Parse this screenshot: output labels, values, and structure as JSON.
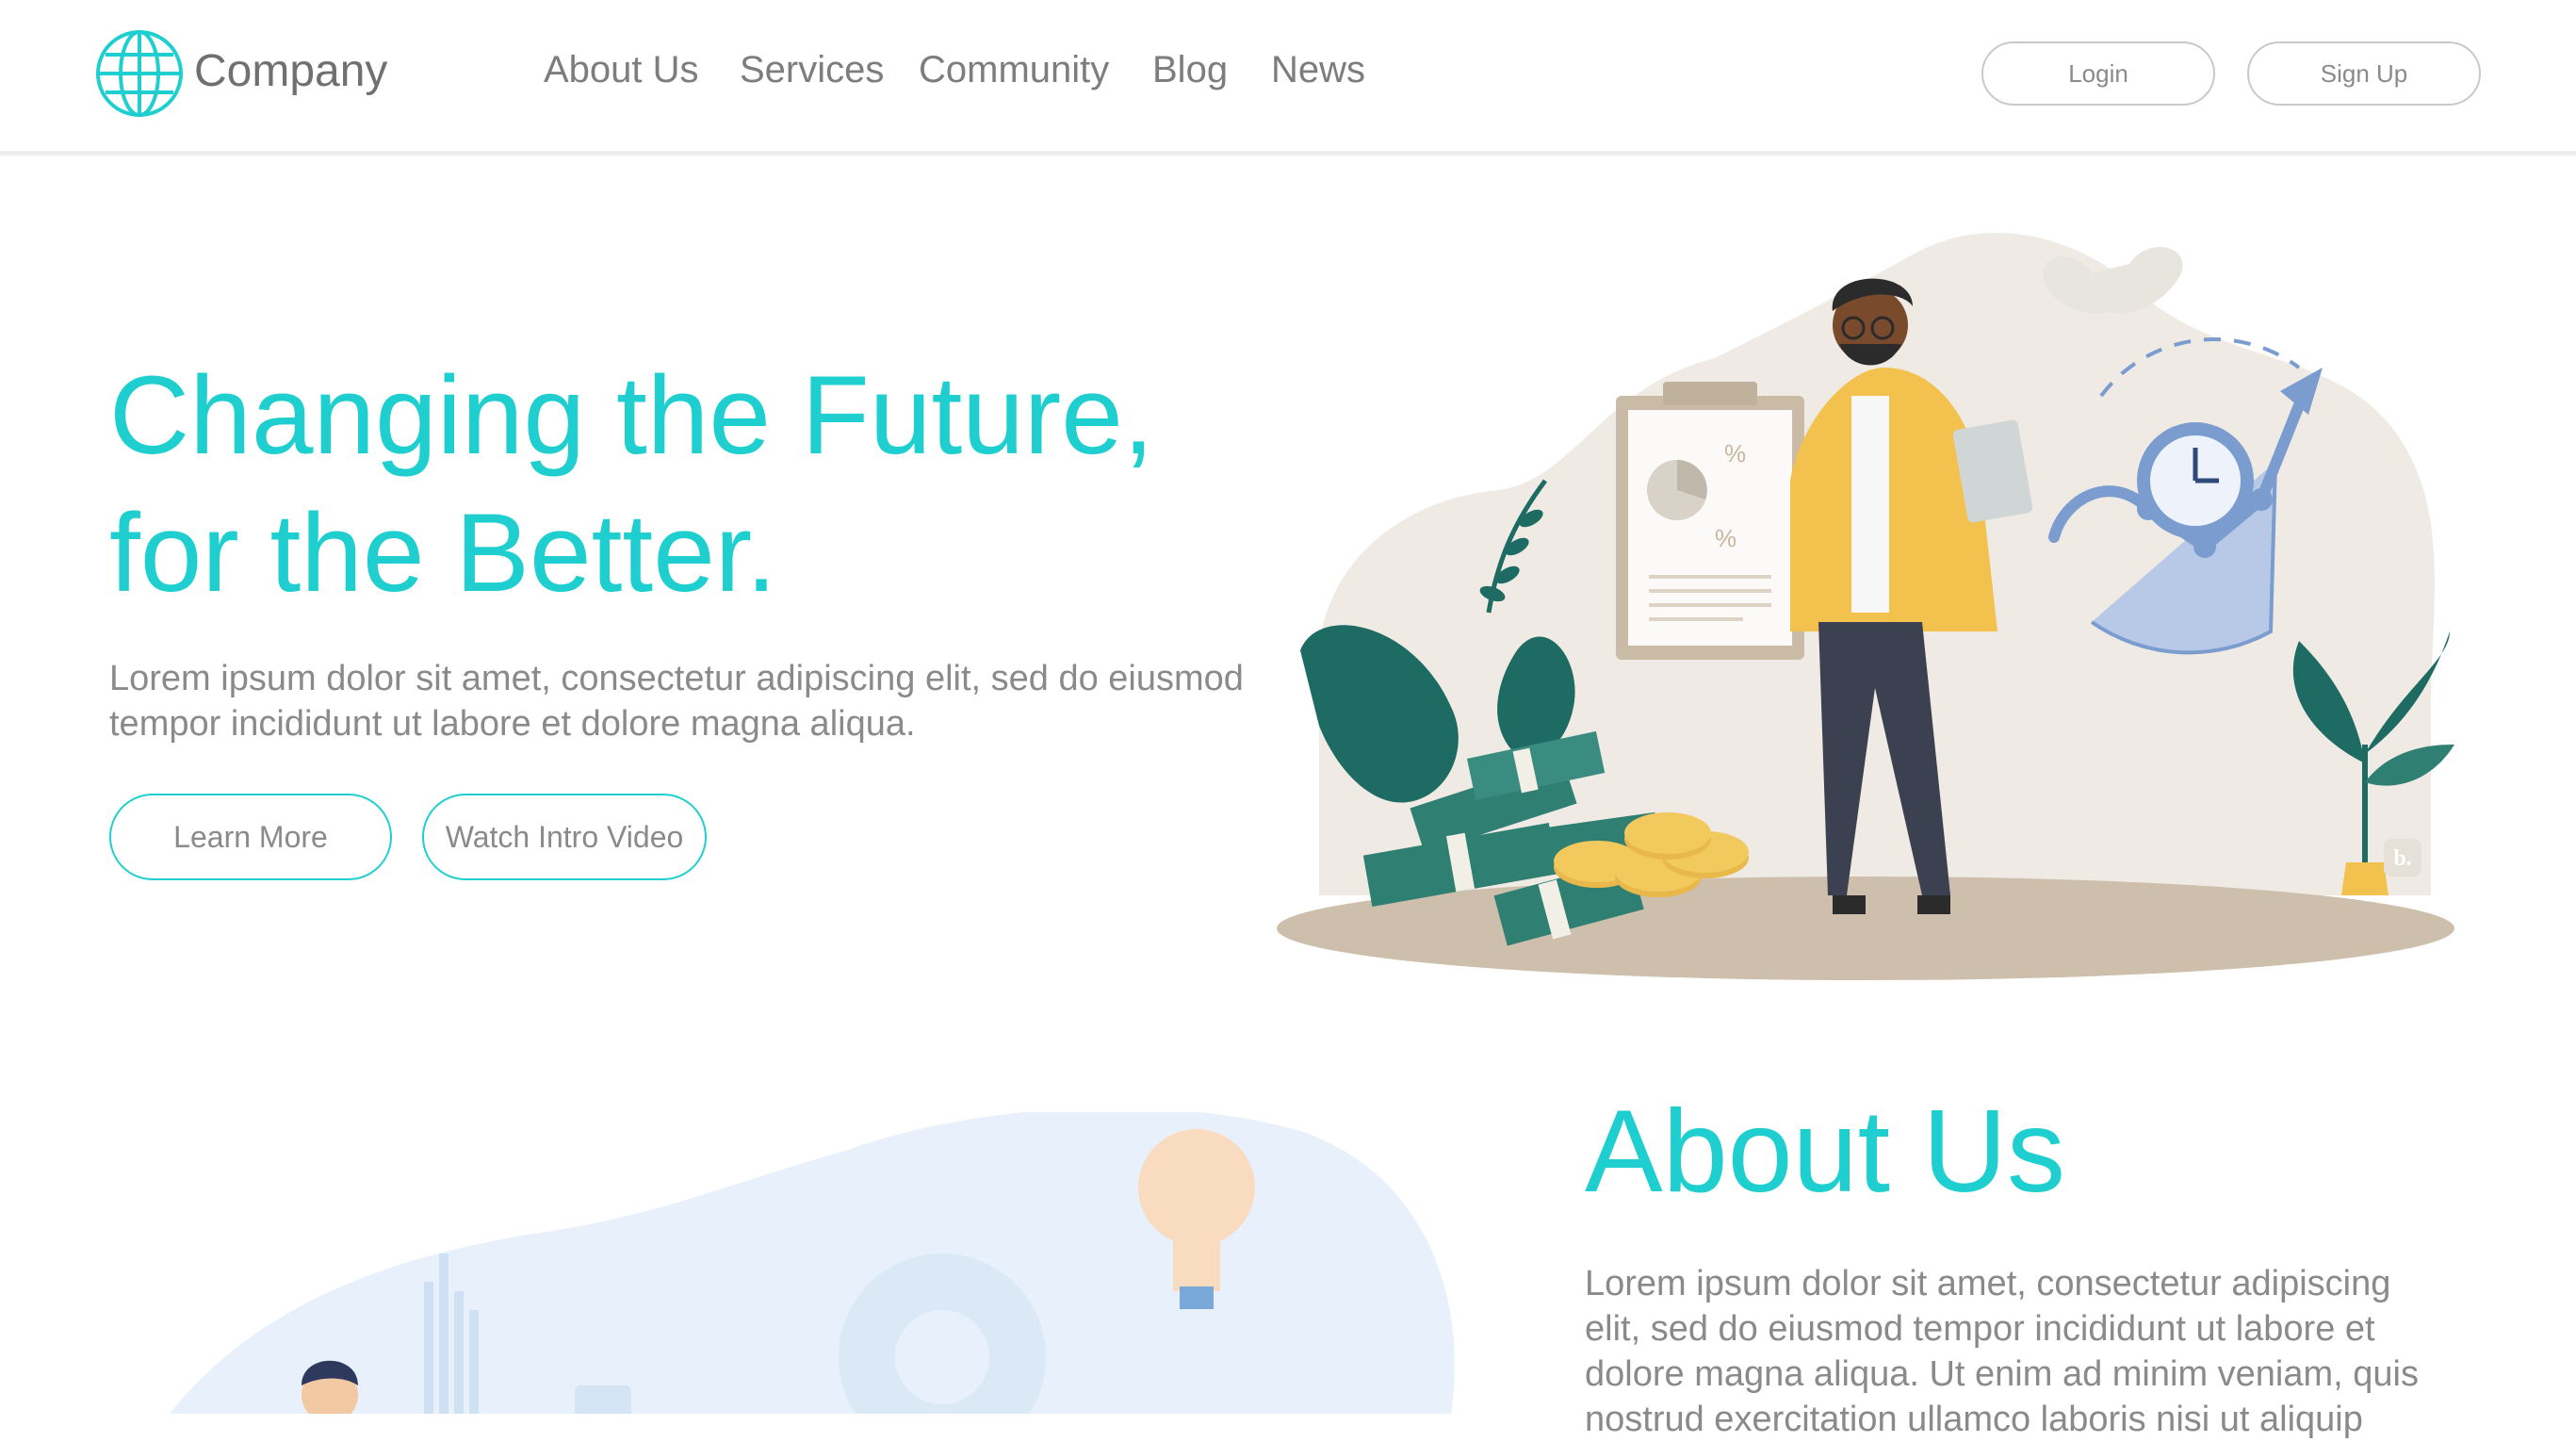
{
  "brand": {
    "name": "Company",
    "logo_icon": "globe-icon",
    "accent": "#1fcfcf"
  },
  "nav": {
    "items": [
      {
        "label": "About Us"
      },
      {
        "label": "Services"
      },
      {
        "label": "Community"
      },
      {
        "label": "Blog"
      },
      {
        "label": "News"
      }
    ]
  },
  "auth": {
    "login_label": "Login",
    "signup_label": "Sign Up"
  },
  "hero": {
    "title_line1": "Changing the Future,",
    "title_line2": "for the Better.",
    "text": "Lorem ipsum dolor sit amet, consectetur adipiscing elit, sed do eiusmod tempor incididunt ut labore et dolore magna aliqua.",
    "learn_more_label": "Learn More",
    "watch_video_label": "Watch Intro Video",
    "illustration": "man-with-laptop-money-clock-illustration",
    "illustration_badge": "b."
  },
  "about": {
    "title": "About Us",
    "text": "Lorem ipsum dolor sit amet, consectetur adipiscing elit, sed do eiusmod tempor incididunt ut labore et dolore magna aliqua. Ut enim ad minim veniam, quis nostrud exercitation ullamco laboris nisi ut aliquip",
    "illustration": "lightbulb-gear-chart-illustration"
  },
  "colors": {
    "teal": "#1fcfcf",
    "dark_green": "#1e6b63",
    "mustard": "#f2c14e",
    "slate_blue": "#7a9ccf",
    "beige": "#efebe4"
  }
}
